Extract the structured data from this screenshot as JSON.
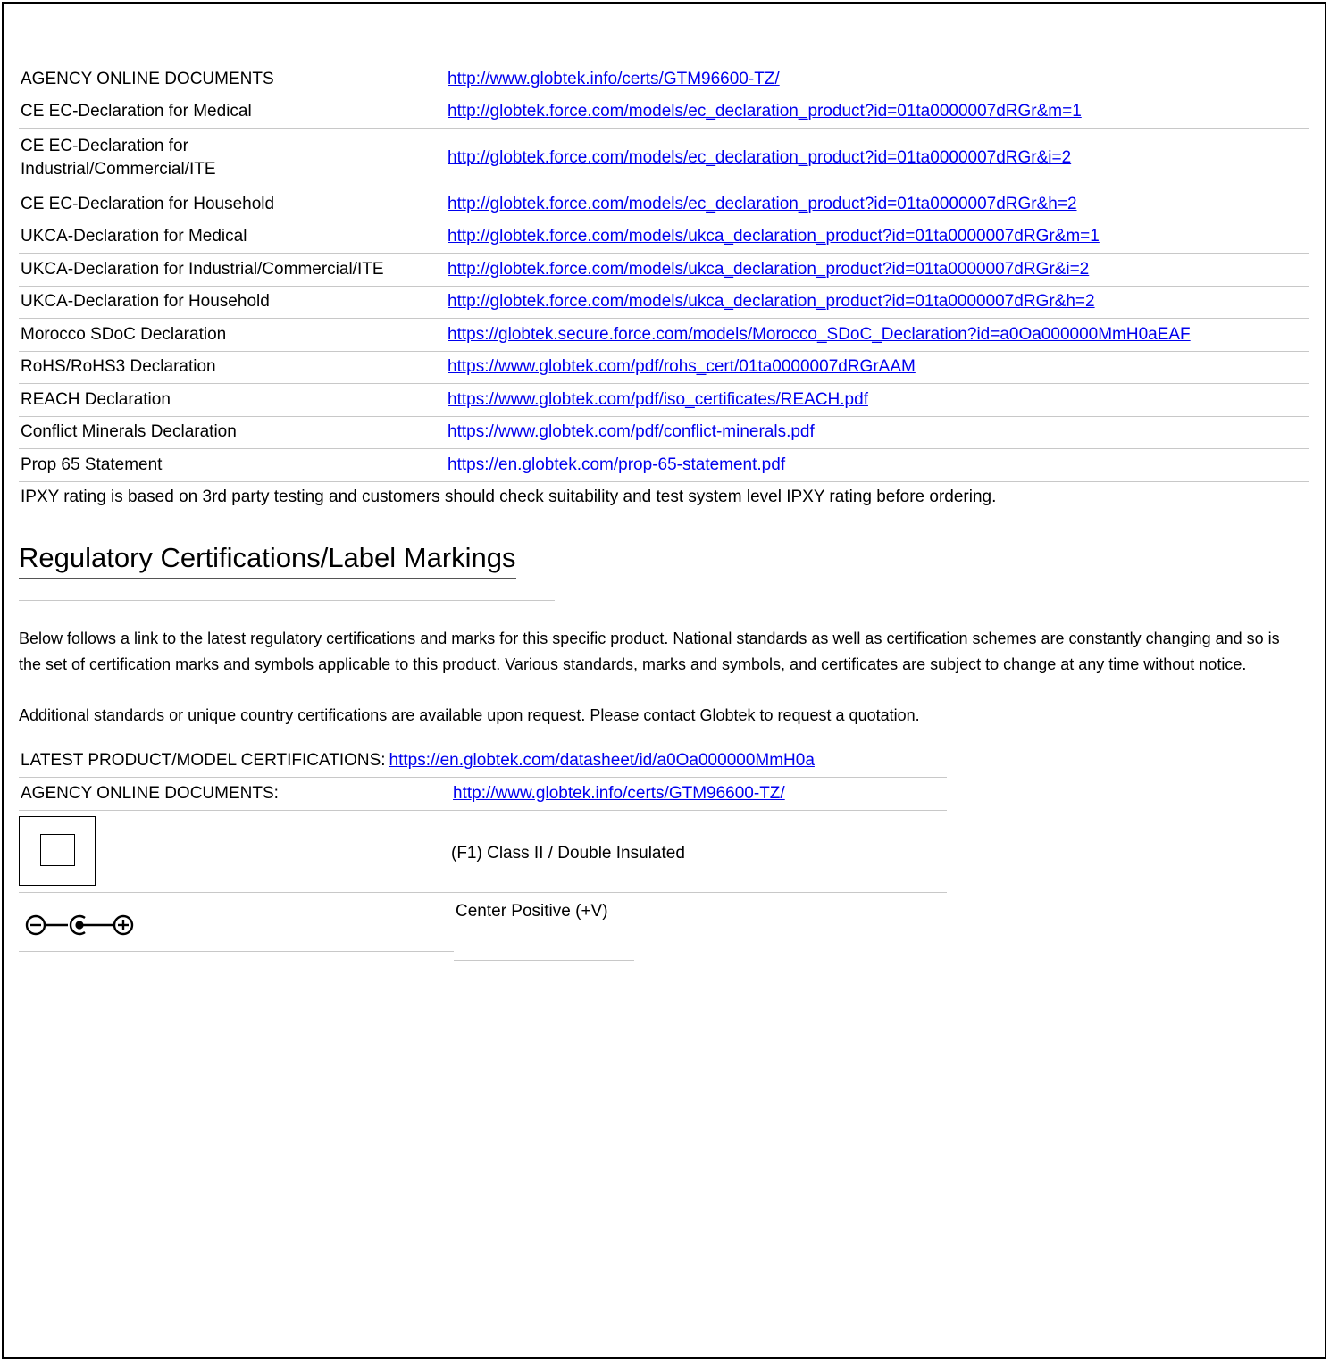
{
  "documents": [
    {
      "label": "AGENCY ONLINE DOCUMENTS",
      "url": "http://www.globtek.info/certs/GTM96600-TZ/"
    },
    {
      "label": "CE EC-Declaration for Medical",
      "url": "http://globtek.force.com/models/ec_declaration_product?id=01ta0000007dRGr&m=1"
    },
    {
      "label": "CE EC-Declaration for Industrial/Commercial/ITE",
      "url": "http://globtek.force.com/models/ec_declaration_product?id=01ta0000007dRGr&i=2"
    },
    {
      "label": "CE EC-Declaration for Household",
      "url": "http://globtek.force.com/models/ec_declaration_product?id=01ta0000007dRGr&h=2"
    },
    {
      "label": "UKCA-Declaration for Medical",
      "url": "http://globtek.force.com/models/ukca_declaration_product?id=01ta0000007dRGr&m=1"
    },
    {
      "label": "UKCA-Declaration for Industrial/Commercial/ITE",
      "url": "http://globtek.force.com/models/ukca_declaration_product?id=01ta0000007dRGr&i=2"
    },
    {
      "label": "UKCA-Declaration for Household",
      "url": "http://globtek.force.com/models/ukca_declaration_product?id=01ta0000007dRGr&h=2"
    },
    {
      "label": "Morocco SDoC Declaration",
      "url": "https://globtek.secure.force.com/models/Morocco_SDoC_Declaration?id=a0Oa000000MmH0aEAF"
    },
    {
      "label": "RoHS/RoHS3 Declaration",
      "url": "https://www.globtek.com/pdf/rohs_cert/01ta0000007dRGrAAM"
    },
    {
      "label": "REACH Declaration",
      "url": "https://www.globtek.com/pdf/iso_certificates/REACH.pdf"
    },
    {
      "label": "Conflict Minerals Declaration",
      "url": "https://www.globtek.com/pdf/conflict-minerals.pdf"
    },
    {
      "label": "Prop 65 Statement",
      "url": "https://en.globtek.com/prop-65-statement.pdf"
    }
  ],
  "ipxy_note": "IPXY rating is based on 3rd party testing and customers should check suitability and test system level IPXY rating before ordering.",
  "regulatory": {
    "title": "Regulatory Certifications/Label Markings",
    "paragraph_1": "Below follows a link to the latest regulatory certifications and marks for this specific product. National standards as well as certification schemes are constantly changing and so is the set of certification marks and symbols applicable to this product. Various standards, marks and symbols, and certificates are subject to change at any time without notice.",
    "paragraph_2": "Additional standards or unique country certifications are available upon request. Please contact Globtek to request a quotation.",
    "latest_label": "LATEST PRODUCT/MODEL CERTIFICATIONS:",
    "latest_url": "https://en.globtek.com/datasheet/id/a0Oa000000MmH0a",
    "agency_label": "AGENCY ONLINE DOCUMENTS:",
    "agency_url": "http://www.globtek.info/certs/GTM96600-TZ/"
  },
  "marks": [
    {
      "icon": "class-ii-double-insulated-icon",
      "text": "(F1) Class II / Double Insulated"
    },
    {
      "icon": "center-positive-polarity-icon",
      "text": "Center Positive (+V)"
    }
  ],
  "colors": {
    "link": "#0000ee",
    "rule": "#c8c8c8"
  }
}
